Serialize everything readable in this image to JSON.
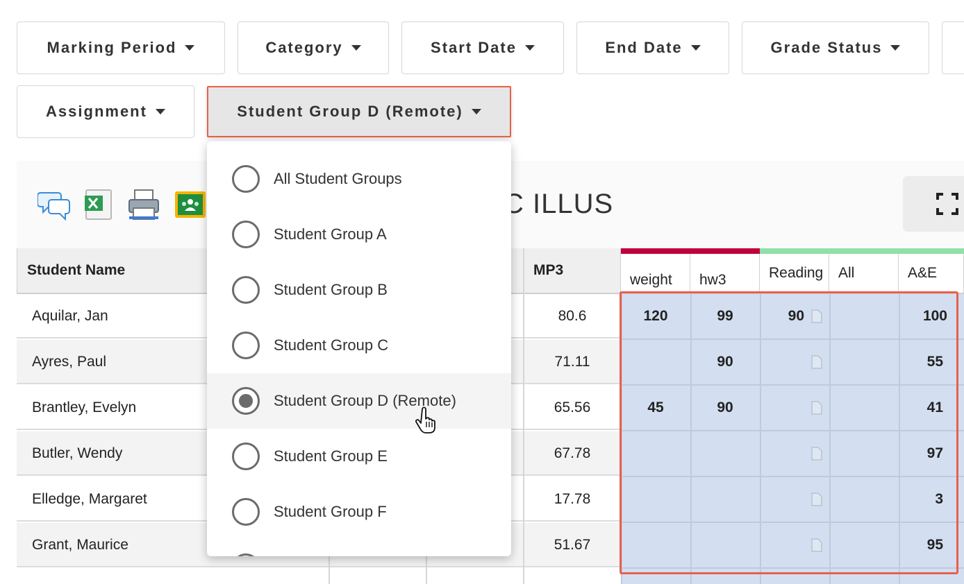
{
  "filters": {
    "marking_period": "Marking Period",
    "category": "Category",
    "start_date": "Start Date",
    "end_date": "End Date",
    "grade_status": "Grade Status",
    "assignment": "Assignment",
    "student_group": "Student Group D (Remote)"
  },
  "toolbar": {
    "icons": [
      "comments-icon",
      "excel-export-icon",
      "print-icon",
      "google-classroom-icon",
      "fullscreen-icon"
    ],
    "heading_fragment": "C ILLUS"
  },
  "table": {
    "headers": {
      "student_name": "Student Name",
      "mp3": "MP3",
      "weight": "weight",
      "hw3": "hw3",
      "reading": "Reading",
      "all": "All",
      "ae": "A&E"
    },
    "band_colors": {
      "red": "#c0003c",
      "green": "#90e0a8"
    },
    "rows": [
      {
        "name": "Aquilar, Jan",
        "mp3": "80.6",
        "weight": "120",
        "hw3": "99",
        "reading": "90",
        "all": "",
        "ae": "100"
      },
      {
        "name": "Ayres, Paul",
        "mp3": "71.11",
        "weight": "",
        "hw3": "90",
        "reading": "",
        "all": "",
        "ae": "55"
      },
      {
        "name": "Brantley, Evelyn",
        "mp3": "65.56",
        "weight": "45",
        "hw3": "90",
        "reading": "",
        "all": "",
        "ae": "41"
      },
      {
        "name": "Butler, Wendy",
        "mp3": "67.78",
        "weight": "",
        "hw3": "",
        "reading": "",
        "all": "",
        "ae": "97"
      },
      {
        "name": "Elledge, Margaret",
        "mp3": "17.78",
        "weight": "",
        "hw3": "",
        "reading": "",
        "all": "",
        "ae": "3"
      },
      {
        "name": "Grant, Maurice",
        "mp3": "51.67",
        "weight": "",
        "hw3": "",
        "reading": "",
        "all": "",
        "ae": "95"
      }
    ]
  },
  "dropdown": {
    "options": [
      {
        "label": "All Student Groups",
        "selected": false
      },
      {
        "label": "Student Group A",
        "selected": false
      },
      {
        "label": "Student Group B",
        "selected": false
      },
      {
        "label": "Student Group C",
        "selected": false
      },
      {
        "label": "Student Group D (Remote)",
        "selected": true
      },
      {
        "label": "Student Group E",
        "selected": false
      },
      {
        "label": "Student Group F",
        "selected": false
      }
    ]
  },
  "colors": {
    "highlight": "#e8604c",
    "grade_area": "#d3dff0"
  }
}
